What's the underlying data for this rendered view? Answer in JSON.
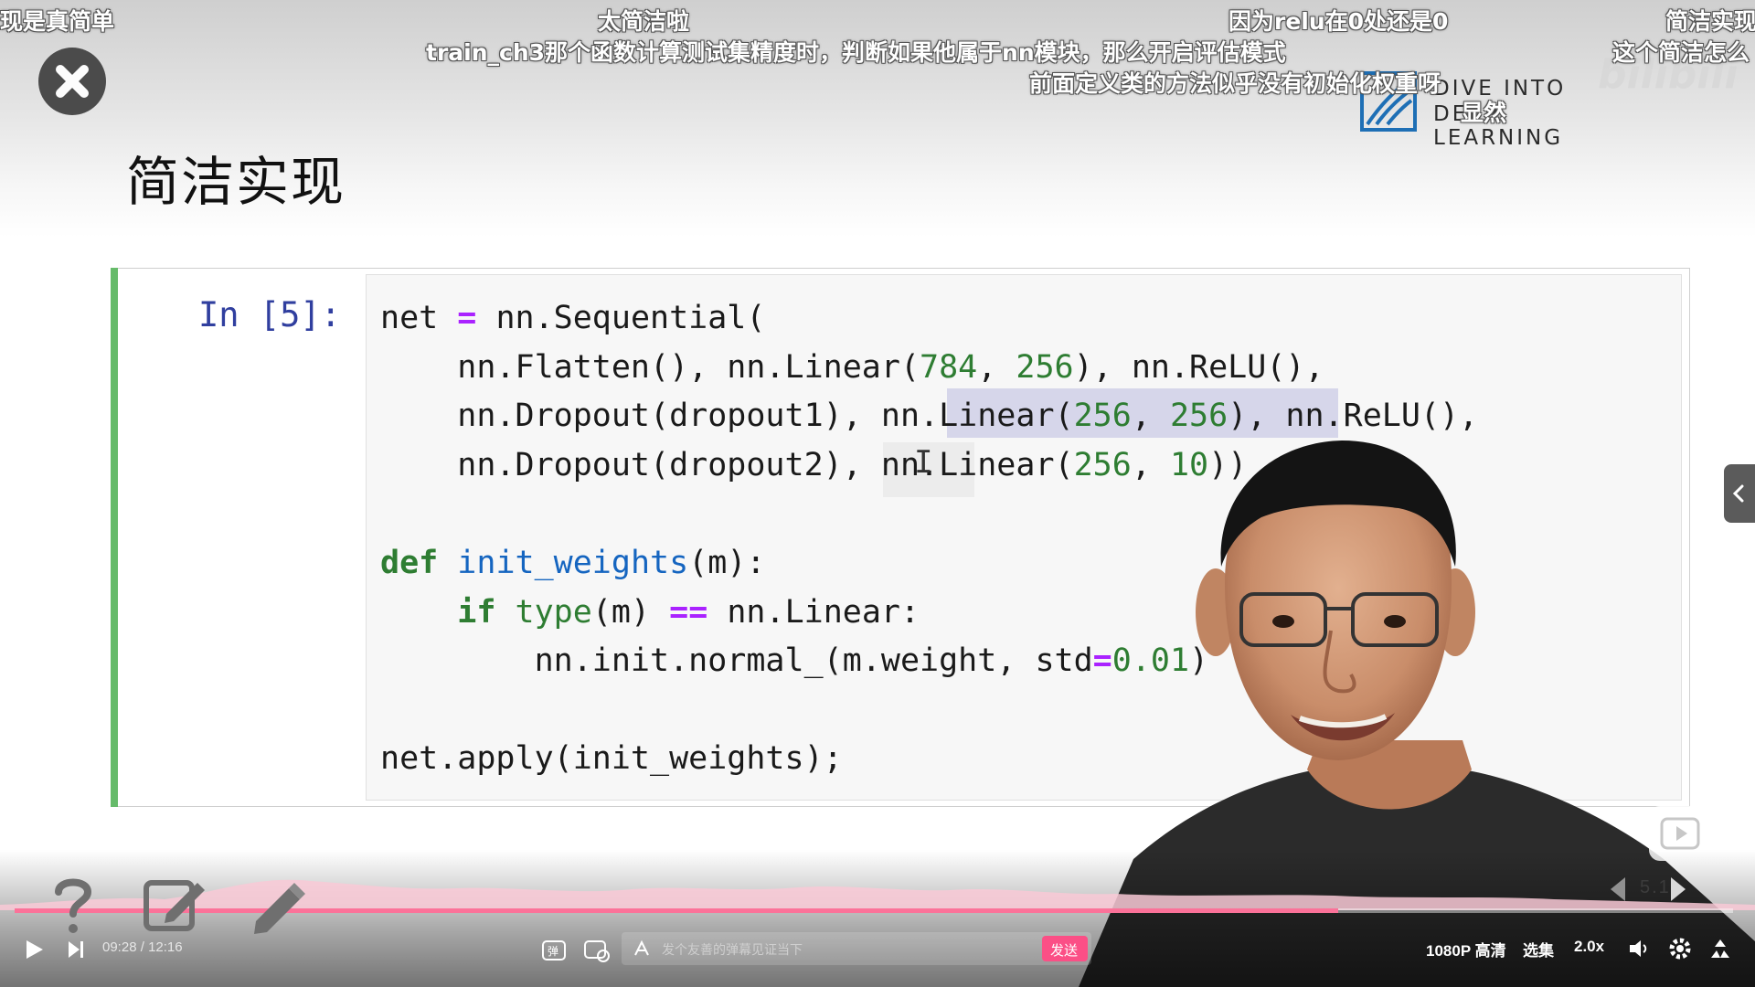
{
  "danmaku": [
    {
      "text": "现是真简单"
    },
    {
      "text": "太简洁啦"
    },
    {
      "text": "因为relu在0处还是0"
    },
    {
      "text": "简洁实现"
    },
    {
      "text": "train_ch3那个函数计算测试集精度时，判断如果他属于nn模块，那么开启评估模式"
    },
    {
      "text": "这个简洁怎么"
    },
    {
      "text": "前面定义类的方法似乎没有初始化权重呀"
    },
    {
      "text": "显然"
    }
  ],
  "slide": {
    "title": "简洁实现",
    "logo_line1": "DIVE INTO",
    "logo_line2": "DEEP LEARNING"
  },
  "cell": {
    "prompt": "In [5]:",
    "code_lines": [
      "net = nn.Sequential(",
      "    nn.Flatten(), nn.Linear(784, 256), nn.ReLU(),",
      "    nn.Dropout(dropout1), nn.Linear(256, 256), nn.ReLU(),",
      "    nn.Dropout(dropout2), nn.Linear(256, 10))",
      "",
      "def init_weights(m):",
      "    if type(m) == nn.Linear:",
      "        nn.init.normal_(m.weight, std=0.01)",
      "",
      "net.apply(init_weights);"
    ]
  },
  "player": {
    "current_time": "09:28",
    "time_separator": "/",
    "duration": "12:16",
    "progress": 0.77,
    "danmaku_placeholder": "发个友善的弹幕见证当下",
    "send_label": "发送",
    "quality": "1080P 高清",
    "episodes": "选集",
    "speed": "2.0x",
    "chapter_badge": "5.1",
    "accent_color": "#fb7299"
  },
  "icons": [
    "close-icon",
    "question-icon",
    "note-edit-icon",
    "pencil-icon",
    "play-icon",
    "next-icon",
    "danmaku-toggle-icon",
    "danmaku-settings-icon",
    "volume-icon",
    "settings-icon",
    "fullscreen-icon",
    "side-panel-chevron-icon",
    "replay-icon"
  ]
}
